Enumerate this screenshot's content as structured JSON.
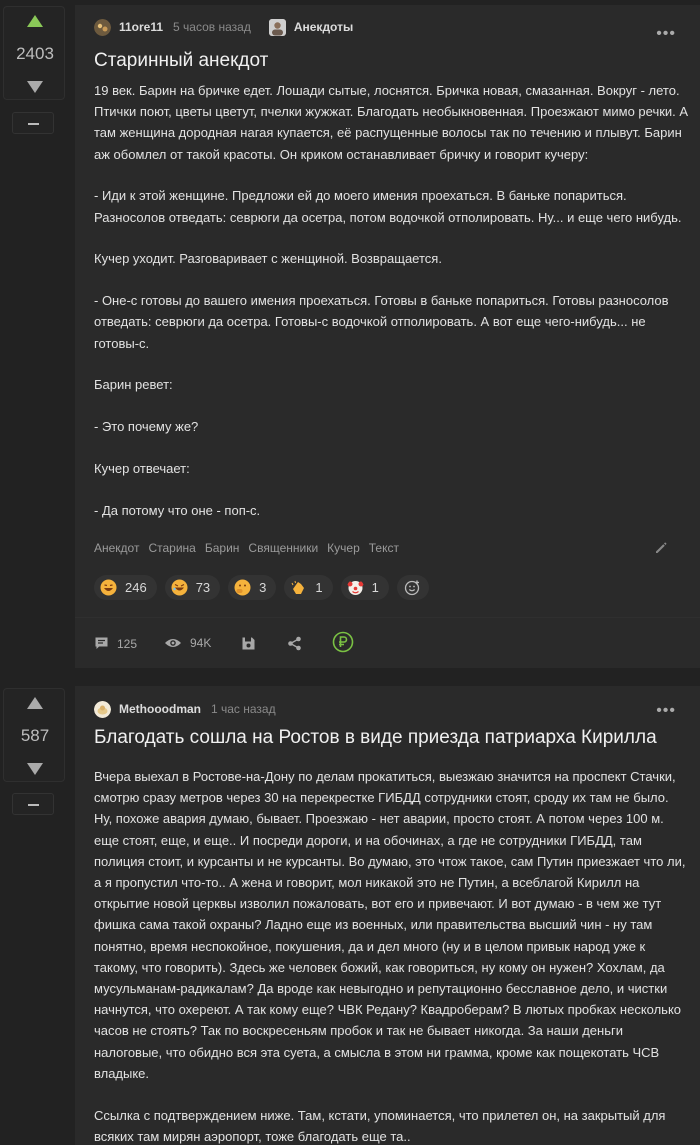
{
  "posts": [
    {
      "rating": "2403",
      "author": "11ore11",
      "time": "5 часов назад",
      "community": "Анекдоты",
      "title": "Старинный анекдот",
      "paragraphs": [
        "19 век. Барин на бричке едет. Лошади сытые, лоснятся. Бричка новая, смазанная. Вокруг - лето. Птички поют, цветы цветут, пчелки жужжат. Благодать необыкновенная. Проезжают мимо речки. А там женщина дородная нагая купается, её распущенные волосы так по течению и плывут. Барин аж обомлел от такой красоты. Он криком останавливает бричку и говорит кучеру:",
        "- Иди к этой женщине. Предложи ей до моего имения проехаться. В баньке попариться. Разносолов отведать: севрюги да осетра, потом водочкой отполировать. Ну... и еще чего нибудь.",
        "Кучер уходит. Разговаривает с женщиной. Возвращается.",
        "- Оне-с готовы до вашего имения проехаться. Готовы в баньке попариться. Готовы разносолов отведать: севрюги да осетра. Готовы-с водочкой отполировать. А вот еще чего-нибудь... не готовы-с.",
        "Барин ревет:",
        "- Это почему же?",
        "Кучер отвечает:",
        "- Да потому что оне - поп-с."
      ],
      "tags": [
        "Анекдот",
        "Старина",
        "Барин",
        "Священники",
        "Кучер",
        "Текст"
      ],
      "reactions": [
        {
          "emoji": "laugh-icon",
          "count": "246"
        },
        {
          "emoji": "rofl-icon",
          "count": "73"
        },
        {
          "emoji": "thinking-icon",
          "count": "3"
        },
        {
          "emoji": "clap-icon",
          "count": "1"
        },
        {
          "emoji": "clown-icon",
          "count": "1"
        }
      ],
      "footer": {
        "comments": "125",
        "views": "94K"
      }
    },
    {
      "rating": "587",
      "author": "Methooodman",
      "time": "1 час назад",
      "title": "Благодать сошла на Ростов в виде приезда патриарха Кирилла",
      "paragraphs": [
        "Вчера выехал в Ростове-на-Дону по делам прокатиться, выезжаю значится на проспект Стачки, смотрю сразу метров через 30 на перекрестке ГИБДД сотрудники стоят, сроду их там не было. Ну, похоже авария думаю, бывает. Проезжаю - нет аварии, просто стоят. А потом через 100 м. еще стоят, еще, и еще.. И посреди дороги, и на обочинах, а где не сотрудники ГИБДД, там полиция стоит, и курсанты и не курсанты. Во думаю, это чтож такое, сам Путин приезжает что ли, а я пропустил что-то.. А жена и говорит, мол никакой это не Путин, а всеблагой Кирилл на открытие новой церквы изволил пожаловать, вот его и привечают. И вот думаю - в чем же тут фишка сама такой охраны? Ладно еще из военных, или правительства высший чин - ну там понятно, время неспокойное, покушения, да и дел много (ну и в целом привык народ уже к такому, что говорить). Здесь же человек божий, как говориться, ну кому он нужен? Хохлам, да мусульманам-радикалам? Да вроде как невыгодно и репутационно бесславное дело, и чистки начнутся, что охереют. А так кому еще? ЧВК Редану? Квадроберам? В лютых пробках несколько часов не стоять? Так по воскресеньям пробок и так не бывает никогда. За наши деньги налоговые, что обидно вся эта суета, а смысла в этом ни грамма, кроме как пощекотать ЧСВ владыке.",
        "Ссылка с подтверждением ниже. Там, кстати, упоминается, что прилетел он, на закрытый для всяких там мирян аэропорт, тоже благодать еще та.."
      ]
    }
  ]
}
